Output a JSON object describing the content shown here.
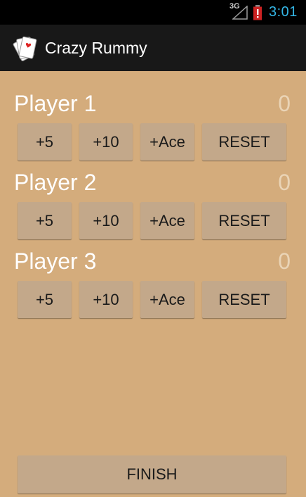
{
  "status_bar": {
    "network": "3G",
    "time": "3:01"
  },
  "app_bar": {
    "title": "Crazy Rummy",
    "icon": "playing-cards-icon"
  },
  "players": [
    {
      "name": "Player 1",
      "score": "0",
      "buttons": {
        "plus5": "+5",
        "plus10": "+10",
        "plus_ace": "+Ace",
        "reset": "RESET"
      }
    },
    {
      "name": "Player 2",
      "score": "0",
      "buttons": {
        "plus5": "+5",
        "plus10": "+10",
        "plus_ace": "+Ace",
        "reset": "RESET"
      }
    },
    {
      "name": "Player 3",
      "score": "0",
      "buttons": {
        "plus5": "+5",
        "plus10": "+10",
        "plus_ace": "+Ace",
        "reset": "RESET"
      }
    }
  ],
  "finish_label": "FINISH",
  "colors": {
    "background": "#d4ac7c",
    "button": "#c3a88a",
    "status_bar": "#000000",
    "action_bar": "#181818",
    "clock": "#33b5e5",
    "battery_alert": "#cc2222"
  }
}
